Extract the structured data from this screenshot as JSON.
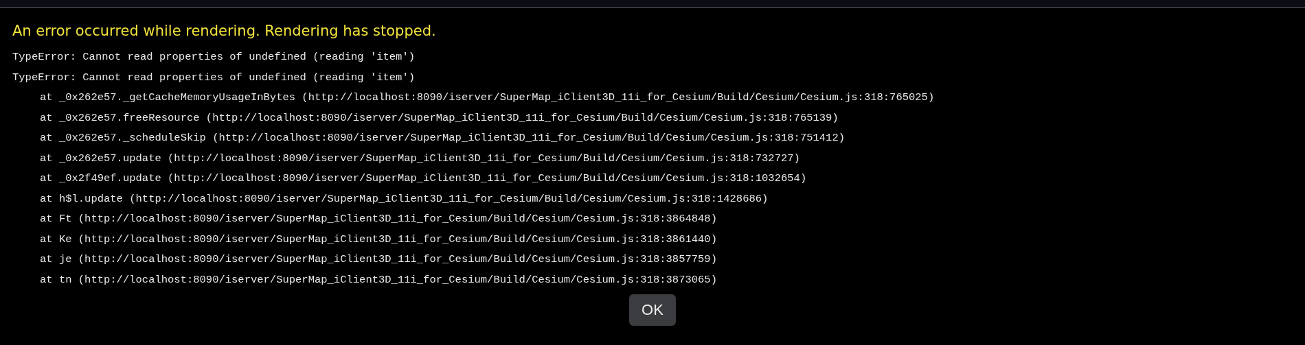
{
  "dialog": {
    "title": "An error occurred while rendering. Rendering has stopped.",
    "message_lines": [
      "TypeError: Cannot read properties of undefined (reading 'item')",
      "TypeError: Cannot read properties of undefined (reading 'item')"
    ],
    "stack_frames": [
      "at _0x262e57._getCacheMemoryUsageInBytes (http://localhost:8090/iserver/SuperMap_iClient3D_11i_for_Cesium/Build/Cesium/Cesium.js:318:765025)",
      "at _0x262e57.freeResource (http://localhost:8090/iserver/SuperMap_iClient3D_11i_for_Cesium/Build/Cesium/Cesium.js:318:765139)",
      "at _0x262e57._scheduleSkip (http://localhost:8090/iserver/SuperMap_iClient3D_11i_for_Cesium/Build/Cesium/Cesium.js:318:751412)",
      "at _0x262e57.update (http://localhost:8090/iserver/SuperMap_iClient3D_11i_for_Cesium/Build/Cesium/Cesium.js:318:732727)",
      "at _0x2f49ef.update (http://localhost:8090/iserver/SuperMap_iClient3D_11i_for_Cesium/Build/Cesium/Cesium.js:318:1032654)",
      "at h$l.update (http://localhost:8090/iserver/SuperMap_iClient3D_11i_for_Cesium/Build/Cesium/Cesium.js:318:1428686)",
      "at Ft (http://localhost:8090/iserver/SuperMap_iClient3D_11i_for_Cesium/Build/Cesium/Cesium.js:318:3864848)",
      "at Ke (http://localhost:8090/iserver/SuperMap_iClient3D_11i_for_Cesium/Build/Cesium/Cesium.js:318:3861440)",
      "at je (http://localhost:8090/iserver/SuperMap_iClient3D_11i_for_Cesium/Build/Cesium/Cesium.js:318:3857759)",
      "at tn (http://localhost:8090/iserver/SuperMap_iClient3D_11i_for_Cesium/Build/Cesium/Cesium.js:318:3873065)"
    ],
    "button": "OK"
  }
}
